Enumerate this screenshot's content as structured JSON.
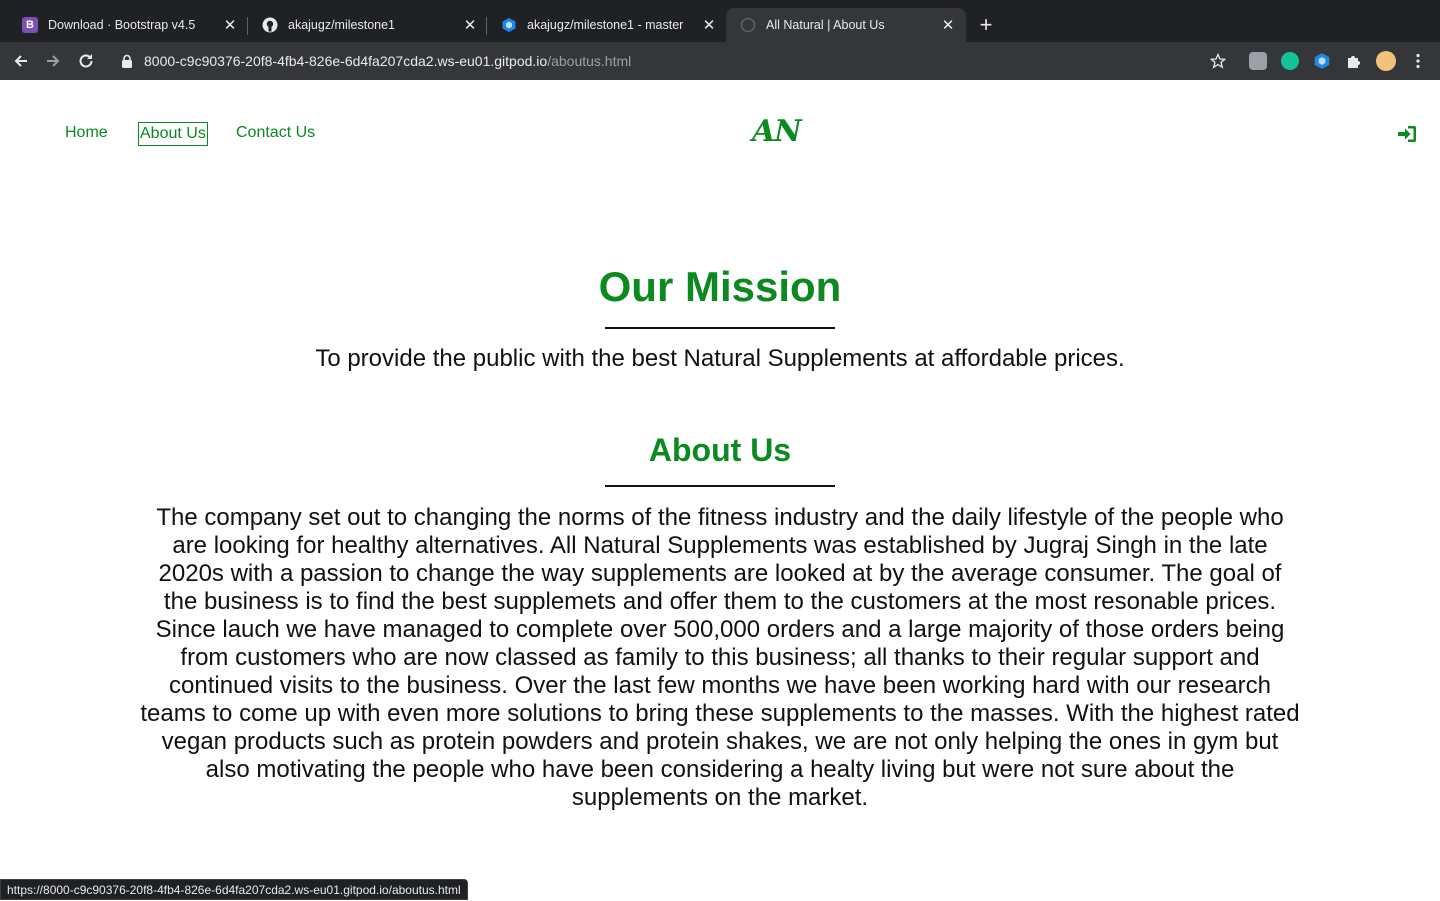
{
  "browser": {
    "tabs": [
      {
        "title": "Download · Bootstrap v4.5",
        "favicon": "bootstrap-icon"
      },
      {
        "title": "akajugz/milestone1",
        "favicon": "github-icon"
      },
      {
        "title": "akajugz/milestone1 - master",
        "favicon": "gitpod-icon"
      },
      {
        "title": "All Natural | About Us",
        "favicon": "globe-icon"
      }
    ],
    "url_host": "8000-c9c90376-20f8-4fb4-826e-6d4fa207cda2.ws-eu01.gitpod.io",
    "url_path": "/aboutus.html",
    "status_url": "https://8000-c9c90376-20f8-4fb4-826e-6d4fa207cda2.ws-eu01.gitpod.io/aboutus.html"
  },
  "nav": {
    "links": [
      "Home",
      "About Us",
      "Contact Us"
    ],
    "brand": "AN",
    "login_icon": "sign-in-icon"
  },
  "mission": {
    "heading": "Our Mission",
    "text": "To provide the public with the best Natural Supplements at affordable prices."
  },
  "about": {
    "heading": "About Us",
    "text": "The company set out to changing the norms of the fitness industry and the daily lifestyle of the people who are looking for healthy alternatives. All Natural Supplements was established by Jugraj Singh in the late 2020s with a passion to change the way supplements are looked at by the average consumer. The goal of the business is to find the best supplemets and offer them to the customers at the most resonable prices. Since lauch we have managed to complete over 500,000 orders and a large majority of those orders being from customers who are now classed as family to this business; all thanks to their regular support and continued visits to the business. Over the last few months we have been working hard with our research teams to come up with even more solutions to bring these supplements to the masses. With the highest rated vegan products such as protein powders and protein shakes, we are not only helping the ones in gym but also motivating the people who have been considering a healty living but were not sure about the supplements on the market."
  },
  "colors": {
    "accent": "#0a8a1f",
    "text": "#111111"
  }
}
